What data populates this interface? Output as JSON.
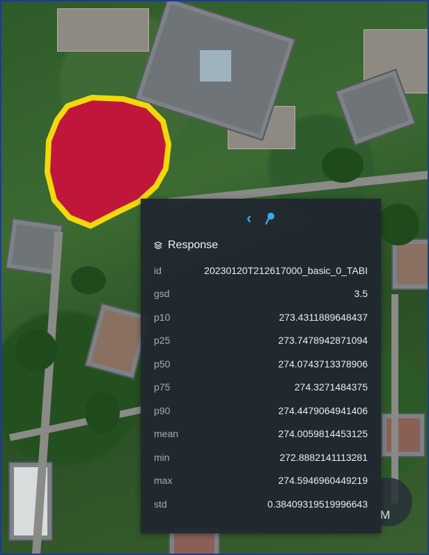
{
  "map": {
    "polygon": {
      "fill": "#c0163a",
      "stroke": "#f2d90a"
    }
  },
  "panel": {
    "nav": {
      "prev_icon": "chevron-left-icon",
      "pin_icon": "map-pin-icon"
    },
    "title": "Response",
    "title_icon": "layers-icon",
    "rows": [
      {
        "key": "id",
        "value": "20230120T212617000_basic_0_TABI"
      },
      {
        "key": "gsd",
        "value": "3.5"
      },
      {
        "key": "p10",
        "value": "273.4311889648437"
      },
      {
        "key": "p25",
        "value": "273.7478942871094"
      },
      {
        "key": "p50",
        "value": "274.0743713378906"
      },
      {
        "key": "p75",
        "value": "274.3271484375"
      },
      {
        "key": "p90",
        "value": "274.4479064941406"
      },
      {
        "key": "mean",
        "value": "274.0059814453125"
      },
      {
        "key": "min",
        "value": "272.8882141113281"
      },
      {
        "key": "max",
        "value": "274.5946960449219"
      },
      {
        "key": "std",
        "value": "0.38409319519996643"
      }
    ],
    "accent_color": "#38a8f0"
  },
  "fab": {
    "label": "M"
  }
}
